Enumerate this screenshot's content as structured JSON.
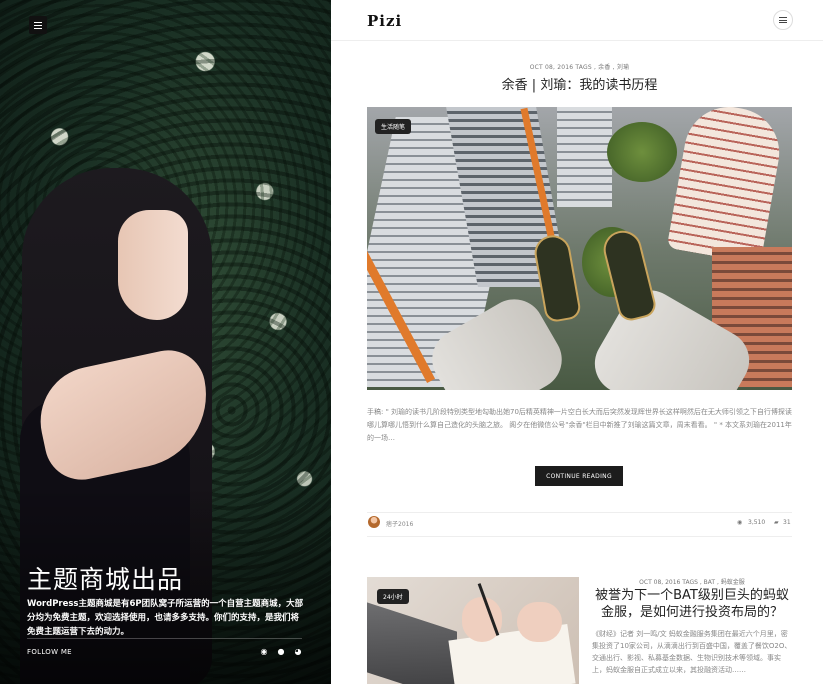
{
  "header": {
    "logo": "Pizi"
  },
  "hero": {
    "title": "主题商城出品",
    "description": "WordPress主题商城是有6P团队窝子所运营的一个自营主题商城，大部分均为免费主题，欢迎选择使用，也请多多支持。你们的支持，是我们将免费主题运营下去的动力。",
    "follow_label": "FOLLOW ME"
  },
  "post1": {
    "meta": "OCT 08, 2016 TAGS , 余香 , 刘瑜",
    "title": "余香 | 刘瑜：我的读书历程",
    "badge": "生活随笔",
    "excerpt": "手稿: \" 刘瑜的读书几阶段特别类型地勾勒出她70后精英精神一片空白长大而后突然发现辉世界长这样啊然后在无大师引领之下自行博探读哪儿算哪儿悟到什么算自己造化的头脑之旅。 阁夕在他微信公号\"余香\"栏目中新推了刘瑜这篇文章，周末看看。 \" * 本文系刘瑜在2011年的一场…",
    "continue_label": "CONTINUE READING",
    "author": "痞子2016",
    "views": "3,510",
    "comments": "31"
  },
  "post2": {
    "meta": "OCT 08, 2016 TAGS , BAT , 蚂蚁金服",
    "title": "被誉为下一个BAT级别巨头的蚂蚁金服，是如何进行投资布局的？",
    "badge": "24小时",
    "excerpt": "《财经》记者 刘一鸣/文 蚂蚁金融服务集团在最近六个月里，密集投资了10家公司，从滴滴出行到百盛中国，覆盖了餐饮O2O、交通出行、影视、私募基金数据、生物识别技术等领域。事实上，蚂蚁金服自正式成立以来，其投融资活动……"
  }
}
